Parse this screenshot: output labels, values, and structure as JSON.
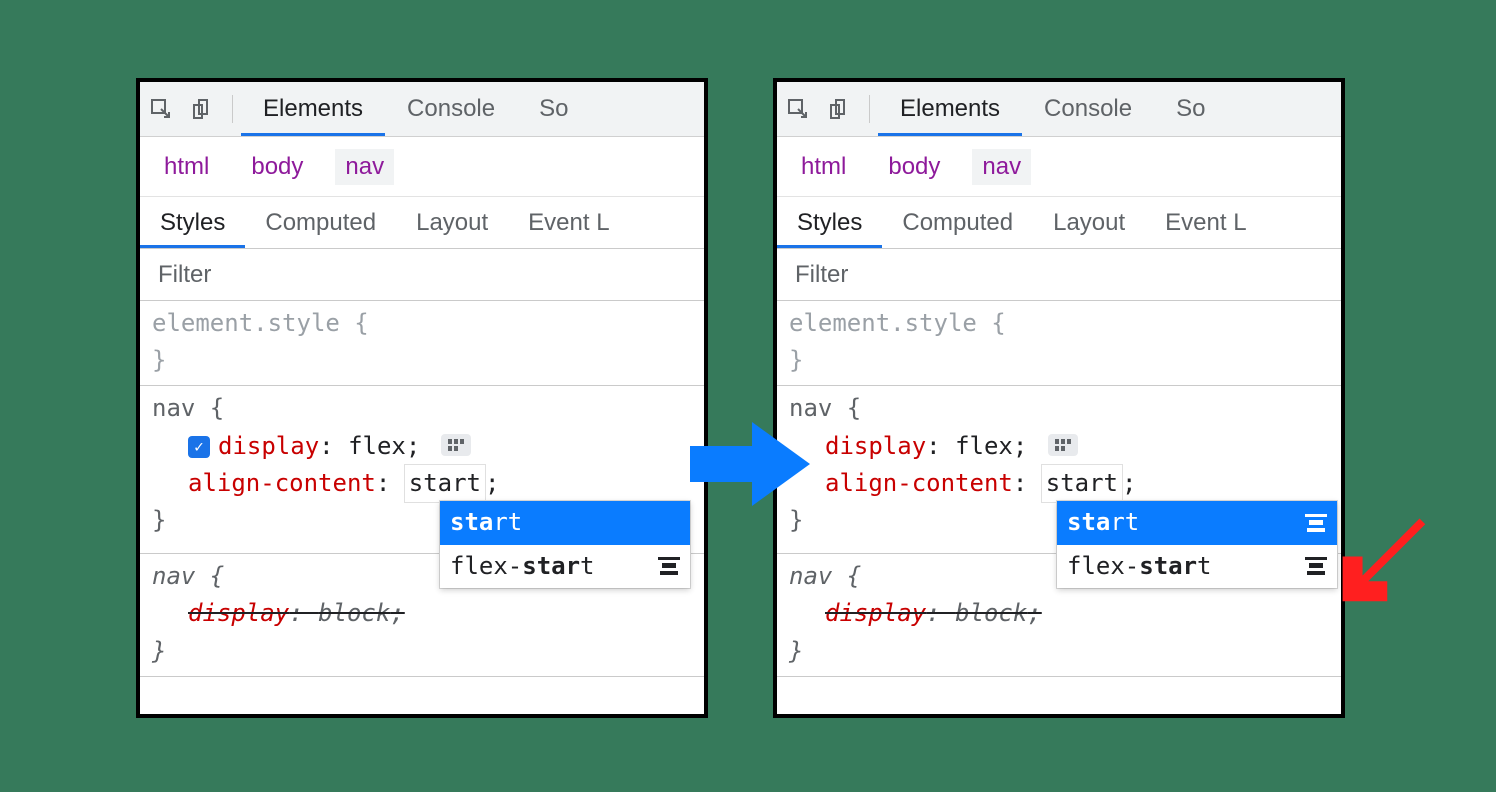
{
  "toolbar": {
    "tab_elements": "Elements",
    "tab_console": "Console",
    "tab_sources_truncated": "So"
  },
  "breadcrumb": {
    "items": [
      "html",
      "body",
      "nav"
    ],
    "selected": "nav"
  },
  "subtabs": {
    "styles": "Styles",
    "computed": "Computed",
    "layout": "Layout",
    "event_truncated": "Event L"
  },
  "filter": {
    "placeholder": "Filter"
  },
  "rule_element_style": {
    "selector": "element.style {",
    "close": "}"
  },
  "rule_nav": {
    "selector": "nav {",
    "prop_display": "display",
    "val_display": "flex",
    "prop_align": "align-content",
    "val_align_typed": "start",
    "close": "}"
  },
  "rule_nav_ua": {
    "selector": "nav {",
    "prop_display": "display",
    "val_display": "block",
    "close": "}"
  },
  "dropdown": {
    "option_start": "start",
    "option_flex_start_prefix": "flex-",
    "option_flex_start_bold": "star",
    "option_flex_start_suffix": "t",
    "option_start_bold": "sta",
    "option_start_rest": "rt"
  },
  "colors": {
    "accent_blue": "#1a73e8",
    "select_blue": "#0a7cff",
    "red_arrow": "#ff1f1f",
    "bg_green": "#367a5b"
  }
}
